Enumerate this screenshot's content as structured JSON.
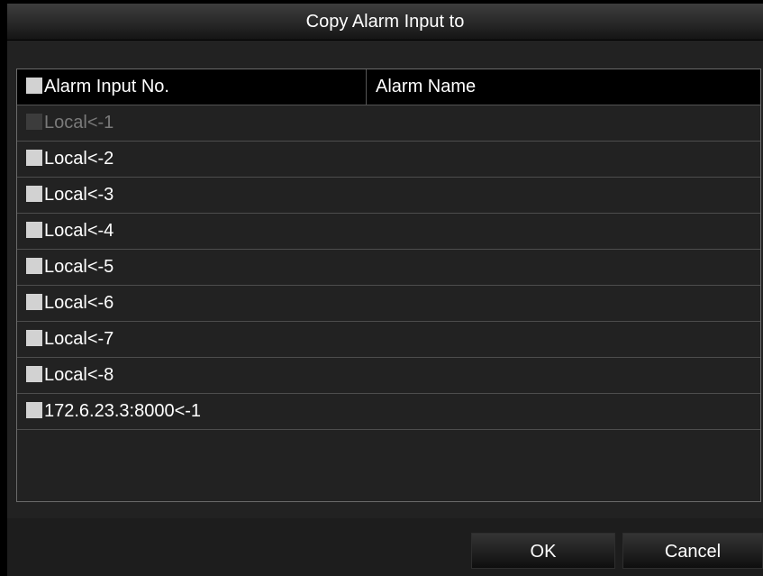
{
  "dialog": {
    "title": "Copy Alarm Input to"
  },
  "table": {
    "headers": {
      "alarm_input_no": "Alarm Input No.",
      "alarm_name": "Alarm Name"
    },
    "select_all_checked": false,
    "rows": [
      {
        "label": "Local<-1",
        "name": "",
        "checked": false,
        "disabled": true
      },
      {
        "label": "Local<-2",
        "name": "",
        "checked": false,
        "disabled": false
      },
      {
        "label": "Local<-3",
        "name": "",
        "checked": false,
        "disabled": false
      },
      {
        "label": "Local<-4",
        "name": "",
        "checked": false,
        "disabled": false
      },
      {
        "label": "Local<-5",
        "name": "",
        "checked": false,
        "disabled": false
      },
      {
        "label": "Local<-6",
        "name": "",
        "checked": false,
        "disabled": false
      },
      {
        "label": "Local<-7",
        "name": "",
        "checked": false,
        "disabled": false
      },
      {
        "label": "Local<-8",
        "name": "",
        "checked": false,
        "disabled": false
      },
      {
        "label": "172.6.23.3:8000<-1",
        "name": "",
        "checked": false,
        "disabled": false
      }
    ]
  },
  "buttons": {
    "ok": "OK",
    "cancel": "Cancel"
  },
  "colors": {
    "checkbox_enabled": "#d2d2d2",
    "checkbox_disabled": "#3c3c3c",
    "disabled_text": "#7a7a7a",
    "text": "#ffffff"
  }
}
